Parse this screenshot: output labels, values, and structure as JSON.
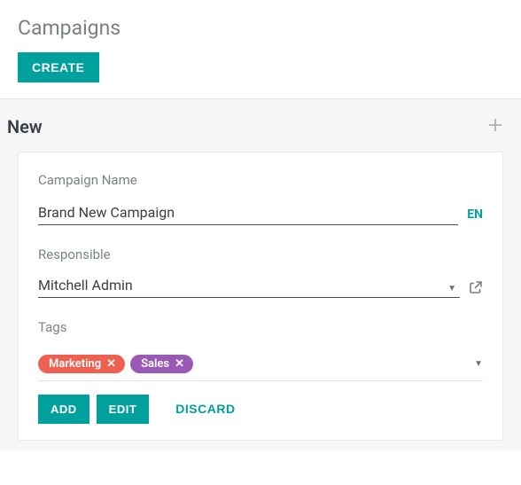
{
  "header": {
    "title": "Campaigns",
    "create_label": "CREATE"
  },
  "section": {
    "title": "New"
  },
  "form": {
    "campaign_name_label": "Campaign Name",
    "campaign_name_value": "Brand New Campaign",
    "lang_badge": "EN",
    "responsible_label": "Responsible",
    "responsible_value": "Mitchell Admin",
    "tags_label": "Tags",
    "tags": [
      {
        "label": "Marketing",
        "color": "#f06050"
      },
      {
        "label": "Sales",
        "color": "#9b59b6"
      }
    ]
  },
  "actions": {
    "add": "ADD",
    "edit": "EDIT",
    "discard": "DISCARD"
  }
}
